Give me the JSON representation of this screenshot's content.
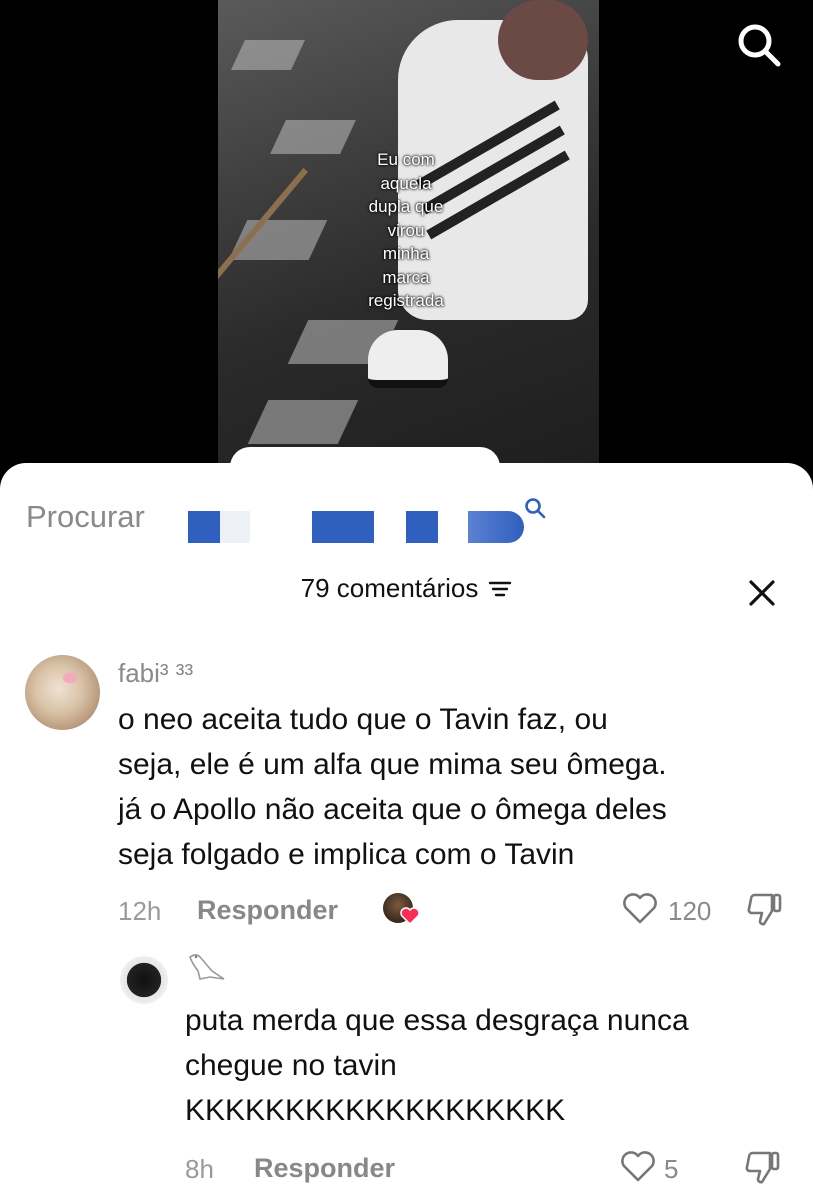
{
  "video": {
    "caption_lines": [
      "Eu com",
      "aquela",
      "dupla que",
      "virou",
      "minha",
      "marca",
      "registrada"
    ],
    "search_icon": "search-icon"
  },
  "search_bar": {
    "label": "Procurar",
    "icon": "search-icon",
    "redaction_color": "#2f5fbf"
  },
  "comments_header": {
    "title": "79 comentários",
    "filter_icon": "filter-icon",
    "close_icon": "close-icon"
  },
  "comments": [
    {
      "username": "fabi³ ³³",
      "text_lines": [
        "o neo aceita tudo que o Tavin faz, ou",
        "seja, ele é um alfa que mima seu ômega.",
        "já o Apollo não aceita que o ômega deles",
        "seja folgado e implica com o Tavin"
      ],
      "time": "12h",
      "reply_label": "Responder",
      "likes": "120",
      "creator_liked": true,
      "avatar": "bunny-avatar"
    },
    {
      "username_icon": "bird-icon",
      "text_lines": [
        "puta merda que essa desgraça nunca",
        "chegue no tavin",
        "KKKKKKKKKKKKKKKKKKK"
      ],
      "time": "8h",
      "reply_label": "Responder",
      "likes": "5",
      "avatar": "black-flower-avatar"
    }
  ],
  "colors": {
    "heart_red": "#fe2c55",
    "muted_text": "#8a8a8a"
  }
}
